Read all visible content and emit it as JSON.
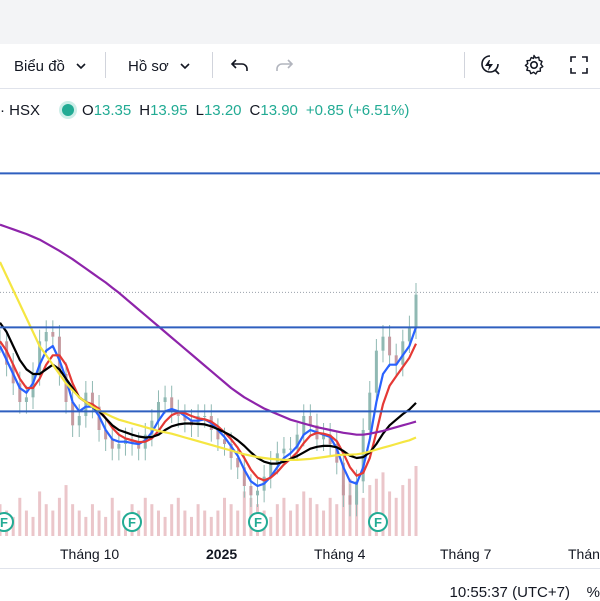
{
  "toolbar": {
    "chart_label": "Biểu đồ",
    "profile_label": "Hồ sơ"
  },
  "icons": {
    "chevron": "chevron-down-icon",
    "undo": "undo-icon",
    "redo": "redo-icon",
    "replay": "replay-icon",
    "settings": "gear-icon",
    "fullscreen": "fullscreen-icon"
  },
  "legend": {
    "symbol": "· HSX",
    "open_key": "O",
    "open": "13.35",
    "high_key": "H",
    "high": "13.95",
    "low_key": "L",
    "low": "13.20",
    "close_key": "C",
    "close": "13.90",
    "change": "+0.85 (+6.51%)"
  },
  "xaxis": {
    "labels": [
      "Tháng 10",
      "2025",
      "Tháng 4",
      "Tháng 7",
      "Thán"
    ]
  },
  "status": {
    "time": "10:55:37 (UTC+7)",
    "pct": "%"
  },
  "colors": {
    "up": "#22ab94",
    "hline": "#2f5fbf",
    "ma_black": "#000000",
    "ma_blue": "#2962ff",
    "ma_red": "#e53935",
    "ma_yellow": "#f5e642",
    "ma_purple": "#8e24aa",
    "volume": "#e6b8bd",
    "candle": "#90b9b3",
    "event": "#22ab94"
  },
  "chart_data": {
    "type": "line",
    "symbol": "HSX",
    "x_labels": [
      "Tháng 10",
      "2025",
      "Tháng 4",
      "Tháng 7",
      "Thán"
    ],
    "ohlc_last": {
      "open": 13.35,
      "high": 13.95,
      "low": 13.2,
      "close": 13.9,
      "change": 0.85,
      "change_pct": 6.51
    },
    "horizontal_lines": [
      16.5,
      13.2,
      11.4
    ],
    "event_markers": [
      {
        "label": "F",
        "index": 0
      },
      {
        "label": "F",
        "index": 1
      },
      {
        "label": "F",
        "index": 2
      },
      {
        "label": "F",
        "index": 3
      }
    ],
    "close": [
      12.9,
      12.4,
      12.0,
      11.6,
      11.7,
      12.2,
      12.9,
      13.1,
      13.0,
      12.2,
      11.6,
      11.1,
      11.3,
      11.8,
      11.5,
      11.0,
      10.8,
      10.6,
      10.7,
      10.8,
      10.7,
      10.6,
      10.9,
      11.2,
      11.6,
      11.7,
      11.4,
      11.3,
      11.2,
      11.1,
      11.3,
      11.3,
      11.0,
      10.8,
      10.7,
      10.4,
      10.2,
      9.8,
      9.6,
      9.7,
      10.0,
      10.3,
      10.5,
      10.6,
      10.6,
      10.9,
      11.3,
      11.1,
      10.8,
      10.9,
      10.7,
      10.3,
      9.6,
      9.4,
      9.9,
      11.0,
      11.8,
      12.7,
      13.0,
      12.6,
      12.4,
      12.9,
      13.2,
      13.9
    ],
    "series": [
      {
        "color": "#2962ff",
        "values": [
          12.8,
          12.5,
          12.2,
          11.9,
          11.8,
          12.0,
          12.4,
          12.7,
          12.8,
          12.5,
          12.1,
          11.6,
          11.4,
          11.5,
          11.5,
          11.3,
          11.0,
          10.8,
          10.75,
          10.75,
          10.72,
          10.7,
          10.78,
          10.95,
          11.2,
          11.4,
          11.45,
          11.4,
          11.3,
          11.2,
          11.2,
          11.23,
          11.15,
          11.0,
          10.85,
          10.65,
          10.45,
          10.15,
          9.9,
          9.8,
          9.85,
          10.0,
          10.2,
          10.4,
          10.5,
          10.65,
          10.9,
          11.0,
          10.95,
          10.9,
          10.85,
          10.6,
          10.2,
          9.9,
          9.85,
          10.2,
          10.8,
          11.6,
          12.2,
          12.4,
          12.4,
          12.6,
          12.8,
          13.2
        ]
      },
      {
        "color": "#e53935",
        "values": [
          12.9,
          12.7,
          12.4,
          12.1,
          11.9,
          11.9,
          12.1,
          12.4,
          12.6,
          12.6,
          12.4,
          12.0,
          11.7,
          11.6,
          11.55,
          11.45,
          11.25,
          11.05,
          10.9,
          10.82,
          10.78,
          10.74,
          10.75,
          10.82,
          10.98,
          11.18,
          11.32,
          11.38,
          11.36,
          11.3,
          11.25,
          11.23,
          11.18,
          11.08,
          10.95,
          10.8,
          10.62,
          10.4,
          10.15,
          9.98,
          9.92,
          9.98,
          10.1,
          10.26,
          10.38,
          10.52,
          10.72,
          10.88,
          10.94,
          10.92,
          10.88,
          10.76,
          10.5,
          10.2,
          10.02,
          10.08,
          10.4,
          10.95,
          11.55,
          11.95,
          12.15,
          12.35,
          12.55,
          12.85
        ]
      },
      {
        "color": "#000000",
        "values": [
          13.3,
          13.1,
          12.8,
          12.5,
          12.3,
          12.2,
          12.2,
          12.3,
          12.4,
          12.3,
          12.1,
          11.9,
          11.7,
          11.6,
          11.5,
          11.4,
          11.25,
          11.1,
          11.0,
          10.95,
          10.9,
          10.86,
          10.84,
          10.85,
          10.9,
          11.0,
          11.08,
          11.12,
          11.14,
          11.14,
          11.13,
          11.12,
          11.08,
          11.02,
          10.95,
          10.88,
          10.78,
          10.66,
          10.52,
          10.4,
          10.32,
          10.28,
          10.28,
          10.32,
          10.38,
          10.44,
          10.52,
          10.6,
          10.64,
          10.66,
          10.66,
          10.63,
          10.55,
          10.45,
          10.4,
          10.42,
          10.52,
          10.7,
          10.92,
          11.1,
          11.22,
          11.34,
          11.44,
          11.58
        ]
      },
      {
        "color": "#f5e642",
        "values": [
          14.6,
          14.3,
          14.0,
          13.7,
          13.4,
          13.1,
          12.8,
          12.6,
          12.4,
          12.2,
          12.0,
          11.85,
          11.7,
          11.6,
          11.5,
          11.42,
          11.35,
          11.28,
          11.22,
          11.18,
          11.14,
          11.1,
          11.06,
          11.02,
          10.98,
          10.95,
          10.92,
          10.88,
          10.84,
          10.8,
          10.76,
          10.72,
          10.68,
          10.64,
          10.6,
          10.56,
          10.52,
          10.48,
          10.45,
          10.42,
          10.4,
          10.38,
          10.37,
          10.36,
          10.36,
          10.36,
          10.37,
          10.38,
          10.4,
          10.42,
          10.44,
          10.46,
          10.47,
          10.47,
          10.48,
          10.5,
          10.54,
          10.58,
          10.62,
          10.66,
          10.7,
          10.74,
          10.78,
          10.84
        ]
      },
      {
        "color": "#8e24aa",
        "values": [
          15.4,
          15.35,
          15.3,
          15.25,
          15.2,
          15.14,
          15.08,
          15.0,
          14.92,
          14.84,
          14.75,
          14.66,
          14.56,
          14.46,
          14.36,
          14.26,
          14.16,
          14.05,
          13.94,
          13.82,
          13.7,
          13.58,
          13.46,
          13.34,
          13.22,
          13.1,
          12.98,
          12.86,
          12.74,
          12.62,
          12.5,
          12.38,
          12.26,
          12.14,
          12.02,
          11.9,
          11.8,
          11.7,
          11.62,
          11.54,
          11.46,
          11.4,
          11.34,
          11.28,
          11.22,
          11.18,
          11.14,
          11.1,
          11.06,
          11.03,
          11.0,
          10.97,
          10.94,
          10.92,
          10.9,
          10.9,
          10.92,
          10.95,
          10.98,
          11.02,
          11.06,
          11.1,
          11.14,
          11.18
        ]
      }
    ],
    "volume": [
      5,
      4,
      3,
      6,
      4,
      3,
      7,
      5,
      4,
      6,
      8,
      5,
      4,
      3,
      5,
      4,
      3,
      6,
      4,
      3,
      5,
      4,
      6,
      5,
      4,
      3,
      5,
      6,
      4,
      3,
      5,
      4,
      3,
      4,
      6,
      5,
      4,
      7,
      6,
      5,
      4,
      3,
      5,
      6,
      4,
      5,
      7,
      6,
      5,
      4,
      6,
      5,
      8,
      9,
      7,
      6,
      8,
      9,
      10,
      7,
      6,
      8,
      9,
      11
    ],
    "ylim": [
      8.6,
      17.6
    ]
  }
}
